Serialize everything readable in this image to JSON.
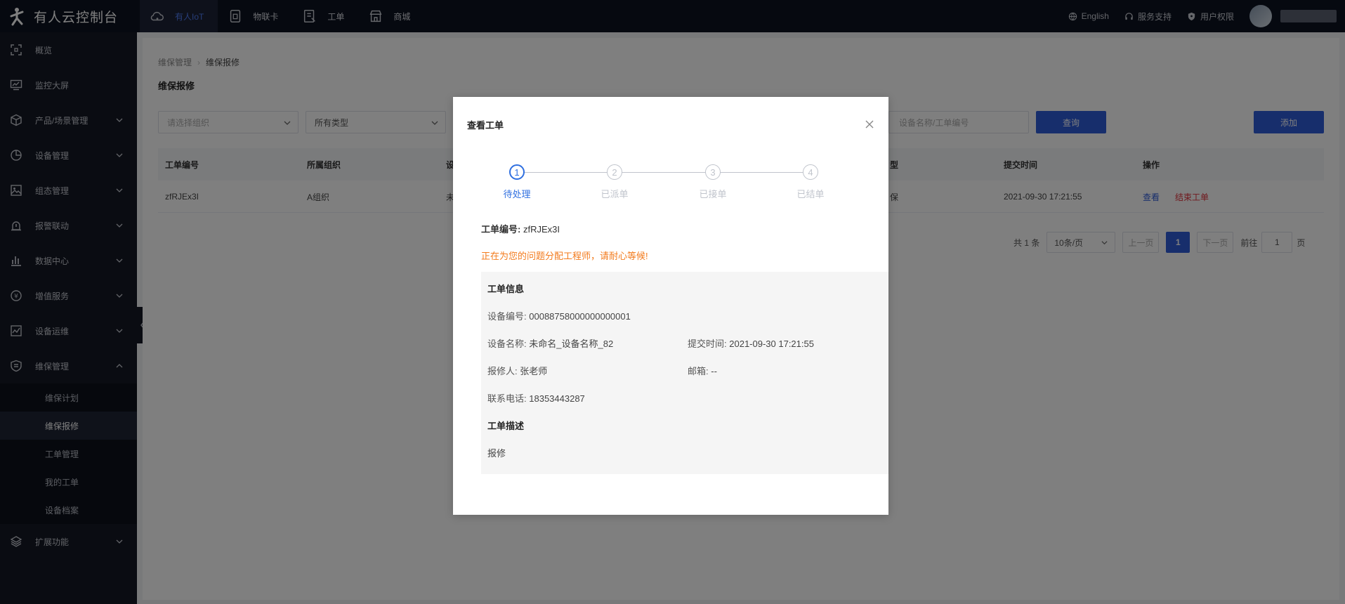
{
  "app": {
    "title": "有人云控制台"
  },
  "topnav": [
    {
      "label": "有人IoT",
      "icon": "cloud-icon",
      "active": true
    },
    {
      "label": "物联卡",
      "icon": "sim-card-icon",
      "active": false
    },
    {
      "label": "工单",
      "icon": "document-icon",
      "active": false
    },
    {
      "label": "商城",
      "icon": "store-icon",
      "active": false
    }
  ],
  "topright": {
    "language": "English",
    "support": "服务支持",
    "permission": "用户权限"
  },
  "sidebar": {
    "items": [
      {
        "label": "概览",
        "icon": "overview-icon"
      },
      {
        "label": "监控大屏",
        "icon": "monitor-icon"
      },
      {
        "label": "产品/场景管理",
        "icon": "cube-icon"
      },
      {
        "label": "设备管理",
        "icon": "pie-icon"
      },
      {
        "label": "组态管理",
        "icon": "image-icon"
      },
      {
        "label": "报警联动",
        "icon": "alarm-icon"
      },
      {
        "label": "数据中心",
        "icon": "bar-chart-icon"
      },
      {
        "label": "增值服务",
        "icon": "yen-icon"
      },
      {
        "label": "设备运维",
        "icon": "ops-chart-icon"
      },
      {
        "label": "维保管理",
        "icon": "shield-list-icon"
      }
    ],
    "sub_items": [
      "维保计划",
      "维保报修",
      "工单管理",
      "我的工单",
      "设备档案"
    ],
    "last_item": {
      "label": "扩展功能",
      "icon": "layers-icon"
    }
  },
  "main": {
    "breadcrumb": [
      "维保管理",
      "维保报修"
    ],
    "title": "维保报修",
    "filters": {
      "org_placeholder": "请选择组织",
      "type_value": "所有类型",
      "search_placeholder": "设备名称/工单编号",
      "query_label": "查询",
      "add_label": "添加"
    },
    "table": {
      "headers": [
        "工单编号",
        "所属组织",
        "设",
        "型",
        "提交时间",
        "操作"
      ],
      "rows": [
        {
          "order_no": "zfRJEx3I",
          "org": "A组织",
          "dev": "未",
          "type": "保",
          "submit_time": "2021-09-30 17:21:55",
          "view": "查看",
          "end": "结束工单"
        }
      ]
    },
    "pager": {
      "total": "共 1 条",
      "page_size": "10条/页",
      "prev": "上一页",
      "current": "1",
      "next": "下一页",
      "goto_label": "前往",
      "goto_value": "1",
      "page_suffix": "页"
    }
  },
  "modal": {
    "title": "查看工单",
    "steps": [
      {
        "num": "1",
        "label": "待处理"
      },
      {
        "num": "2",
        "label": "已派单"
      },
      {
        "num": "3",
        "label": "已接单"
      },
      {
        "num": "4",
        "label": "已结单"
      }
    ],
    "order_label": "工单编号:",
    "order_value": "zfRJEx3I",
    "notice": "正在为您的问题分配工程师，请耐心等候!",
    "info_title": "工单信息",
    "device_no_label": "设备编号:",
    "device_no": "00088758000000000001",
    "device_name_label": "设备名称:",
    "device_name": "未命名_设备名称_82",
    "submit_time_label": "提交时间:",
    "submit_time": "2021-09-30 17:21:55",
    "reporter_label": "报修人:",
    "reporter": "张老师",
    "email_label": "邮箱:",
    "email": "--",
    "phone_label": "联系电话:",
    "phone": "18353443287",
    "desc_title": "工单描述",
    "desc": "报修"
  }
}
